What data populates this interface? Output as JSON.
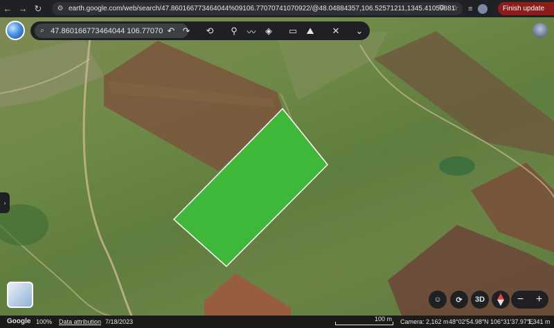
{
  "browser": {
    "url": "earth.google.com/web/search/47.860166773464044%09106.7707074107092​2/@48.04884357,106.52571211,1345.41059881",
    "finish_update_label": "Finish update"
  },
  "toolbar": {
    "search_value": "47.860166773464044 106.77070",
    "icons": [
      "search-icon",
      "undo-icon",
      "redo-icon",
      "history-icon",
      "placemark-icon",
      "path-icon",
      "layers-icon",
      "measure-icon",
      "image-icon",
      "tools-icon",
      "chevron-down-icon"
    ]
  },
  "map_controls": {
    "three_d_label": "3D",
    "zoom_out_label": "−",
    "zoom_in_label": "+"
  },
  "status": {
    "brand": "Google",
    "zoom_percent": "100%",
    "data_attribution": "Data attribution",
    "imagery_date": "7/18/2023",
    "scale_label": "100 m",
    "camera": "Camera: 2,162 m",
    "coordinates": "48°02′54.98″N 106°31′37.97″E",
    "elevation": "1,341 m"
  },
  "colors": {
    "polygon_fill": "#3fb83a",
    "polygon_stroke": "#ffffff",
    "finish_update_bg": "#8c1d18",
    "toolbar_bg": "#1f2023"
  }
}
